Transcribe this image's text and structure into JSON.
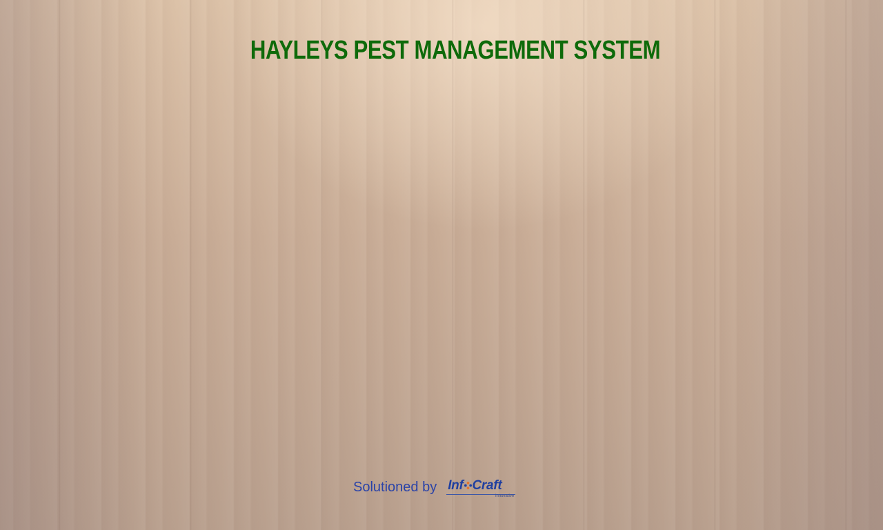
{
  "app": {
    "title": "HAYLEYS PEST MANAGEMENT SYSTEM"
  },
  "footer": {
    "credit_text": "Solutioned by",
    "logo_text_left": "Inf",
    "logo_text_right": "Craft",
    "logo_tagline": "innovative",
    "logo_icon": "diamond-dots-icon"
  },
  "colors": {
    "title": "#0e6a0a",
    "credit_text": "#2a43a8",
    "logo_blue": "#1f3fa0",
    "logo_orange": "#e8742a"
  }
}
